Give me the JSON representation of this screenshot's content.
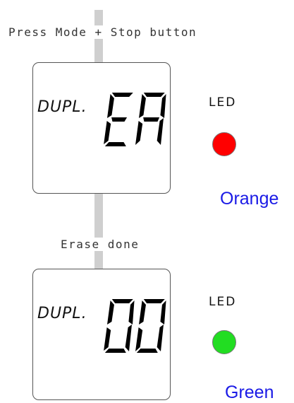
{
  "colors": {
    "led_red": "#ff0000",
    "led_green": "#22dd22",
    "label_blue": "#1a1ae6"
  },
  "steps": [
    {
      "instruction": "Press Mode + Stop button",
      "display_mode": "DUPL.",
      "display_value": "EA",
      "led_label": "LED",
      "led_color_name": "Orange"
    },
    {
      "instruction": "Erase done",
      "display_mode": "DUPL.",
      "display_value": "00",
      "led_label": "LED",
      "led_color_name": "Green"
    }
  ]
}
